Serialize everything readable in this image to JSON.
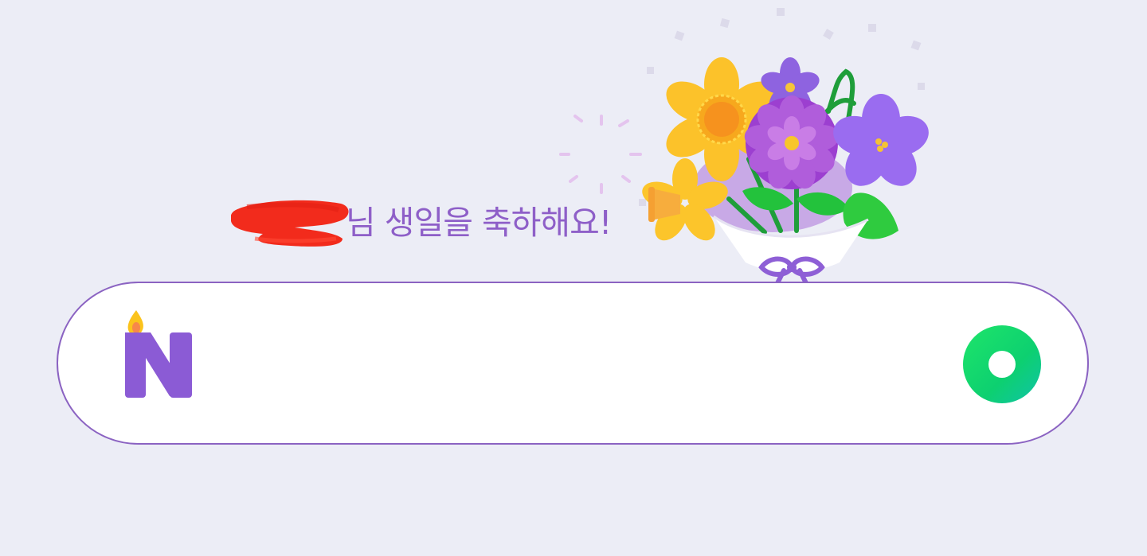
{
  "greeting": {
    "text": "님 생일을 축하해요!",
    "name_redacted": true
  },
  "search": {
    "value": "",
    "placeholder": ""
  },
  "logo": {
    "letter": "N",
    "icon": "birthday-candle-n-icon"
  },
  "lens": {
    "icon": "green-ring-lens-icon",
    "aria_label": ""
  },
  "illustration": {
    "icon": "flower-bouquet-icon"
  },
  "colors": {
    "background": "#ecedf6",
    "accent_purple": "#8e5fc8",
    "border_purple": "#8b63c2",
    "lens_green": "#13d26a",
    "redaction_red": "#f22b1c"
  }
}
